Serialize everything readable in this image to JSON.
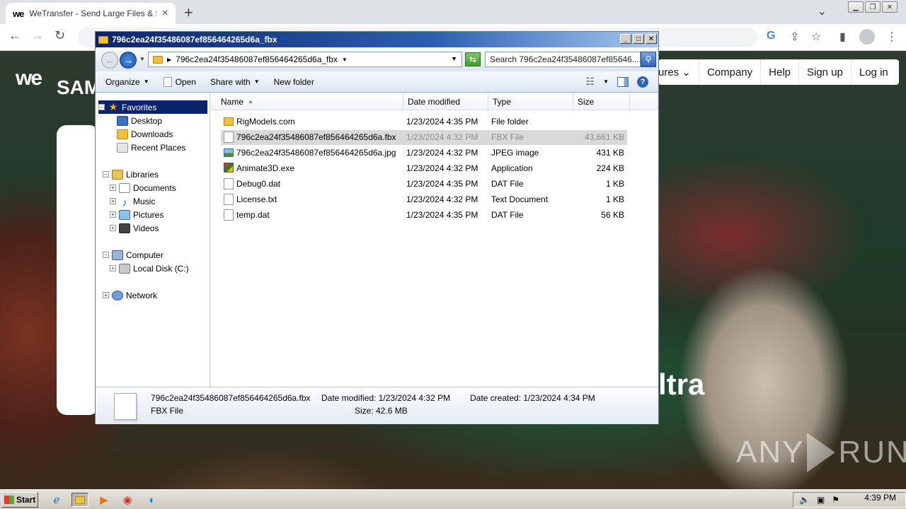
{
  "browser": {
    "tab_title": "WeTransfer - Send Large Files & Sha",
    "tab_favicon": "we",
    "icons": [
      "back-icon",
      "forward-icon",
      "reload-icon",
      "lock-icon",
      "google-icon",
      "share-icon",
      "star-icon",
      "sidebar-icon",
      "profile-icon",
      "kebab-menu-icon"
    ]
  },
  "wetransfer": {
    "logo": "we",
    "hero_fragment": "SAM",
    "nav": [
      "ures",
      "Company",
      "Help",
      "Sign up",
      "Log in"
    ],
    "nav_chevron": "⌄",
    "bottom_fragment": "ltra",
    "watermark": "ANY RUN"
  },
  "explorer": {
    "title": "796c2ea24f35486087ef856464265d6a_fbx",
    "address": "796c2ea24f35486087ef856464265d6a_fbx",
    "search_placeholder": "Search 796c2ea24f35486087ef85646...",
    "commands": {
      "organize": "Organize",
      "open": "Open",
      "share_with": "Share with",
      "new_folder": "New folder"
    },
    "nav_pane": {
      "favorites": "Favorites",
      "desktop": "Desktop",
      "downloads": "Downloads",
      "recent": "Recent Places",
      "libraries": "Libraries",
      "documents": "Documents",
      "music": "Music",
      "pictures": "Pictures",
      "videos": "Videos",
      "computer": "Computer",
      "local_disk": "Local Disk (C:)",
      "network": "Network"
    },
    "columns": {
      "name": "Name",
      "date": "Date modified",
      "type": "Type",
      "size": "Size"
    },
    "files": [
      {
        "name": "RigModels.com",
        "date": "1/23/2024 4:35 PM",
        "type": "File folder",
        "size": "",
        "icon": "folder-icon"
      },
      {
        "name": "796c2ea24f35486087ef856464265d6a.fbx",
        "date": "1/23/2024 4:32 PM",
        "type": "FBX File",
        "size": "43,661 KB",
        "icon": "file-icon"
      },
      {
        "name": "796c2ea24f35486087ef856464265d6a.jpg",
        "date": "1/23/2024 4:32 PM",
        "type": "JPEG image",
        "size": "431 KB",
        "icon": "image-file-icon"
      },
      {
        "name": "Animate3D.exe",
        "date": "1/23/2024 4:32 PM",
        "type": "Application",
        "size": "224 KB",
        "icon": "exe-icon"
      },
      {
        "name": "Debug0.dat",
        "date": "1/23/2024 4:35 PM",
        "type": "DAT File",
        "size": "1 KB",
        "icon": "file-icon"
      },
      {
        "name": "License.txt",
        "date": "1/23/2024 4:32 PM",
        "type": "Text Document",
        "size": "1 KB",
        "icon": "text-file-icon"
      },
      {
        "name": "temp.dat",
        "date": "1/23/2024 4:35 PM",
        "type": "DAT File",
        "size": "56 KB",
        "icon": "file-icon"
      }
    ],
    "details": {
      "filename": "796c2ea24f35486087ef856464265d6a.fbx",
      "filetype": "FBX File",
      "date_modified": "Date modified: 1/23/2024 4:32 PM",
      "size": "Size: 42.6 MB",
      "date_created": "Date created: 1/23/2024 4:34 PM"
    }
  },
  "taskbar": {
    "start": "Start",
    "clock": "4:39 PM"
  }
}
